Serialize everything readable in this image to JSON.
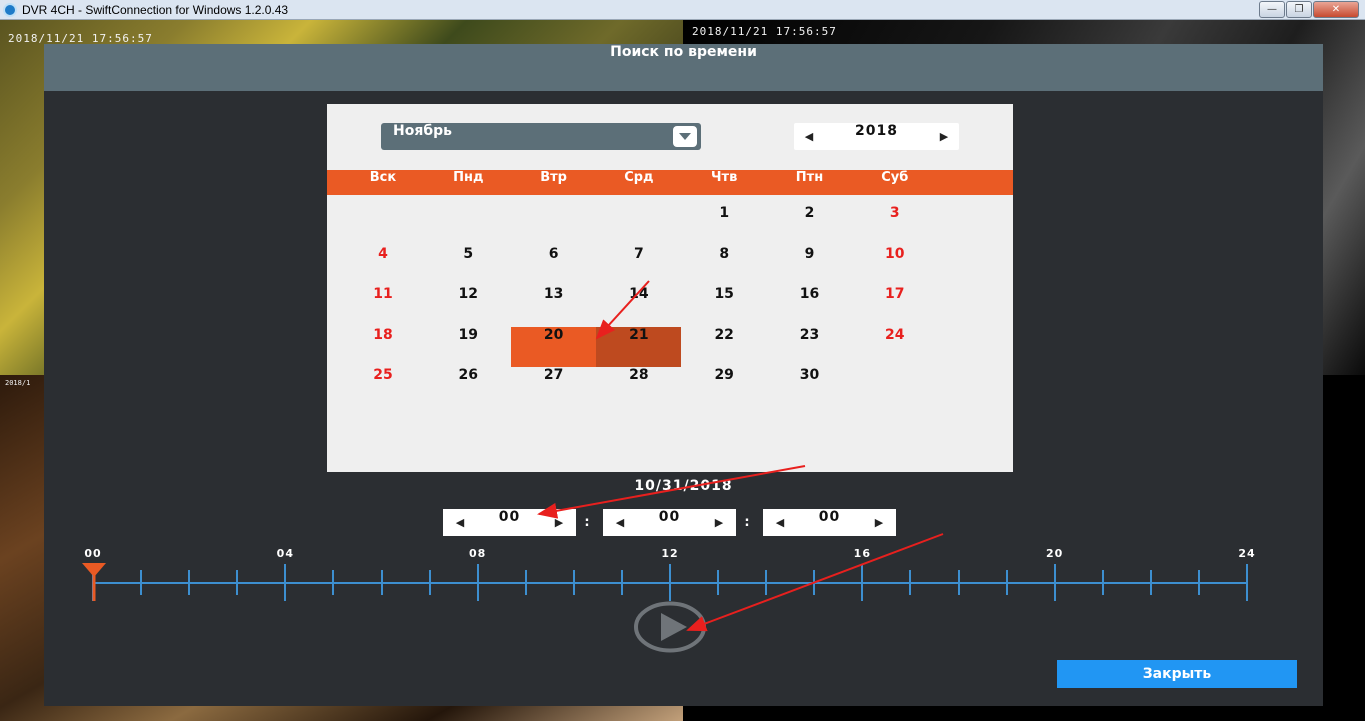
{
  "window": {
    "title": "DVR 4CH - SwiftConnection for Windows 1.2.0.43",
    "min_label": "—",
    "max_label": "❐",
    "close_label": "✕"
  },
  "cameras": {
    "ts1": "2018/11/21 17:56:57",
    "ts2": "2018/11/21 17:56:57",
    "ts3": "2018/1"
  },
  "dialog": {
    "title": "Поиск по времени",
    "month": "Ноябрь",
    "year": "2018",
    "weekdays": [
      "Вск",
      "Пнд",
      "Втр",
      "Срд",
      "Чтв",
      "Птн",
      "Суб"
    ],
    "days": [
      "1",
      "2",
      "3",
      "4",
      "5",
      "6",
      "7",
      "8",
      "9",
      "10",
      "11",
      "12",
      "13",
      "14",
      "15",
      "16",
      "17",
      "18",
      "19",
      "20",
      "21",
      "22",
      "23",
      "24",
      "25",
      "26",
      "27",
      "28",
      "29",
      "30"
    ],
    "selected_day": "20",
    "current_day": "21",
    "selected_date": "10/31/2018",
    "time": {
      "hours": "00",
      "minutes": "00",
      "seconds": "00",
      "separator": ":"
    },
    "timeline_labels": [
      "00",
      "04",
      "08",
      "12",
      "16",
      "20",
      "24"
    ],
    "close_label": "Закрыть",
    "arrow_left": "◀",
    "arrow_right": "▶"
  },
  "colors": {
    "accent": "#ea5a24",
    "header": "#5c6f78",
    "timeline": "#3d8fd0",
    "button": "#2196f3",
    "weekend": "#e8201e",
    "annotation": "#e8201e"
  },
  "icons": {
    "dropdown": "chevron-down-icon",
    "play": "play-icon",
    "marker": "timeline-marker-icon"
  }
}
